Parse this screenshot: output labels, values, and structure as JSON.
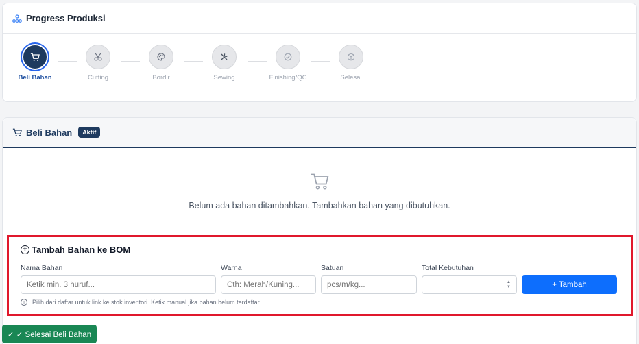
{
  "progress": {
    "title": "Progress Produksi",
    "steps": [
      {
        "label": "Beli Bahan",
        "icon": "cart-icon",
        "active": true
      },
      {
        "label": "Cutting",
        "icon": "scissors-icon",
        "active": false
      },
      {
        "label": "Bordir",
        "icon": "palette-icon",
        "active": false
      },
      {
        "label": "Sewing",
        "icon": "tools-icon",
        "active": false
      },
      {
        "label": "Finishing/QC",
        "icon": "check-circle-icon",
        "active": false
      },
      {
        "label": "Selesai",
        "icon": "box-icon",
        "active": false
      }
    ]
  },
  "beli": {
    "title": "Beli Bahan",
    "badge": "Aktif",
    "empty_message": "Belum ada bahan ditambahkan. Tambahkan bahan yang dibutuhkan."
  },
  "bom": {
    "title": "Tambah Bahan ke BOM",
    "fields": {
      "nama": {
        "label": "Nama Bahan",
        "placeholder": "Ketik min. 3 huruf..."
      },
      "warna": {
        "label": "Warna",
        "placeholder": "Cth: Merah/Kuning..."
      },
      "satuan": {
        "label": "Satuan",
        "placeholder": "pcs/m/kg..."
      },
      "total": {
        "label": "Total Kebutuhan",
        "placeholder": ""
      }
    },
    "add_button": "+ Tambah",
    "hint": "Pilih dari daftar untuk link ke stok inventori. Ketik manual jika bahan belum terdaftar."
  },
  "finish_button": "✓ ✓ Selesai Beli Bahan",
  "colors": {
    "primary": "#1e3a5f",
    "accent": "#0d6efd",
    "success": "#198754",
    "highlight": "#e0182c"
  }
}
